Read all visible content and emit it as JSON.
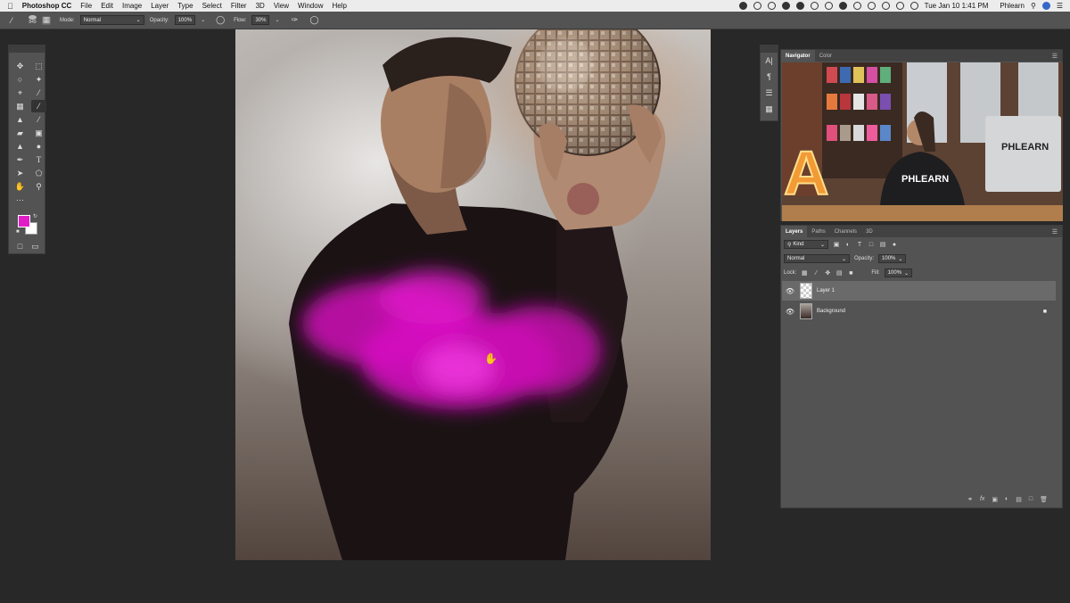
{
  "menubar": {
    "app_name": "Photoshop CC",
    "menus": [
      "File",
      "Edit",
      "Image",
      "Layer",
      "Type",
      "Select",
      "Filter",
      "3D",
      "View",
      "Window",
      "Help"
    ],
    "clock": "Tue Jan 10  1:41 PM",
    "user": "Phlearn"
  },
  "options_bar": {
    "brush_size": "849",
    "mode_label": "Mode:",
    "mode_value": "Normal",
    "opacity_label": "Opacity:",
    "opacity_value": "100%",
    "flow_label": "Flow:",
    "flow_value": "30%"
  },
  "tools": {
    "foreground_color": "#e11ec6",
    "background_color": "#ffffff",
    "active": "brush-tool"
  },
  "navigator_panel": {
    "tabs": [
      "Navigator",
      "Color"
    ],
    "thumb_sign_text": "PHLEARN",
    "thumb_shirt_text": "PHLEARN",
    "thumb_letter": "A"
  },
  "layers_panel": {
    "tabs": [
      "Layers",
      "Paths",
      "Channels",
      "3D"
    ],
    "filter_label": "Kind",
    "blend_mode": "Normal",
    "opacity_label": "Opacity:",
    "opacity_value": "100%",
    "lock_label": "Lock:",
    "fill_label": "Fill:",
    "fill_value": "100%",
    "layers": [
      {
        "name": "Layer 1",
        "selected": true
      },
      {
        "name": "Background",
        "selected": false
      }
    ]
  },
  "colors": {
    "accent_paint": "#e11ec6",
    "panel_bg": "#535353",
    "workspace_bg": "#282828"
  }
}
